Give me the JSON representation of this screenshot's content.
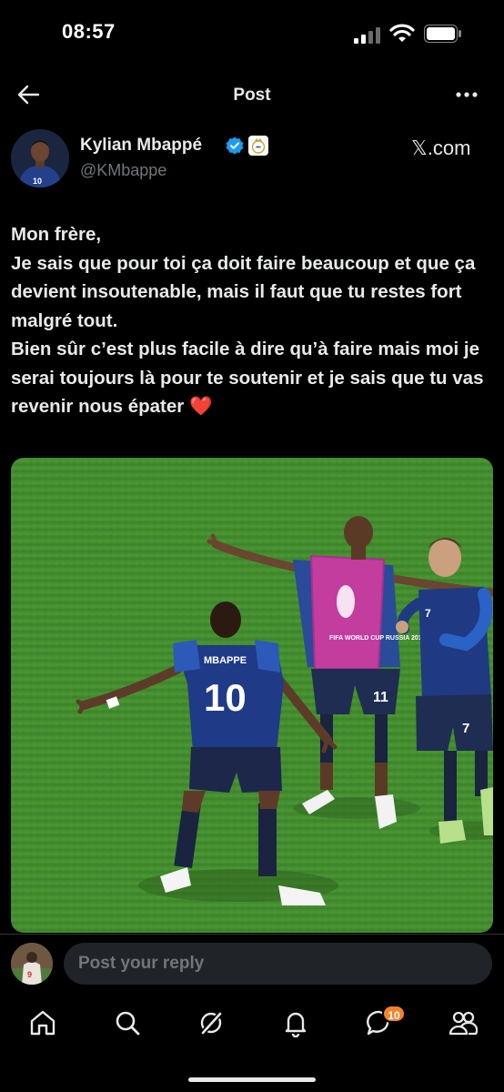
{
  "status_bar": {
    "time": "08:57"
  },
  "header": {
    "title": "Post"
  },
  "author": {
    "name": "Kylian Mbappé",
    "handle": "@KMbappe",
    "source": "𝕏.com"
  },
  "post": {
    "text": "Mon frère,\nJe sais que pour toi ça doit faire beaucoup et que ça devient insoutenable, mais il faut que tu restes fort malgré tout.\nBien sûr c’est plus facile à dire qu’à faire mais moi je serai toujours là pour te soutenir et je sais que tu vas revenir nous épater",
    "heart": "❤️",
    "photo": {
      "jersey_left_name": "MBAPPE",
      "jersey_left_number": "10",
      "jersey_center_number": "11",
      "jersey_right_number": "7",
      "bib_text": "FIFA WORLD CUP RUSSIA 2018"
    }
  },
  "reply": {
    "placeholder": "Post your reply"
  },
  "tabbar": {
    "messages_badge": "10"
  },
  "colors": {
    "background": "#000000",
    "text": "#e7e9ea",
    "muted": "#71767b",
    "verified": "#1d9bf0",
    "badge": "#f4822a"
  }
}
